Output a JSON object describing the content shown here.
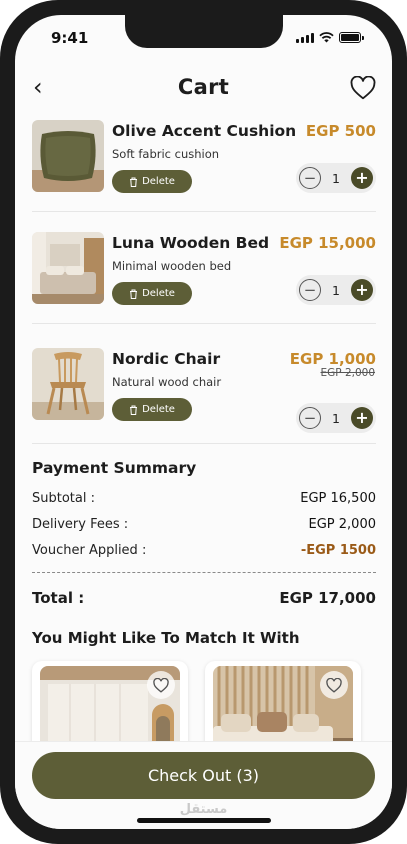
{
  "status_bar": {
    "time": "9:41"
  },
  "header": {
    "title": "Cart",
    "back_icon": "chevron-left-icon",
    "favorite_icon": "heart-icon"
  },
  "cart_items": [
    {
      "name": "Olive Accent Cushion",
      "description": "Soft fabric cushion",
      "price": "EGP 500",
      "old_price": "",
      "quantity": "1",
      "delete_label": "Delete",
      "image": "cushion-image"
    },
    {
      "name": "Luna Wooden Bed",
      "description": "Minimal wooden bed",
      "price": "EGP 15,000",
      "old_price": "",
      "quantity": "1",
      "delete_label": "Delete",
      "image": "bed-image"
    },
    {
      "name": "Nordic Chair",
      "description": "Natural wood chair",
      "price": "EGP 1,000",
      "old_price": "EGP 2,000",
      "quantity": "1",
      "delete_label": "Delete",
      "image": "chair-image"
    }
  ],
  "summary": {
    "title": "Payment Summary",
    "subtotal_label": "Subtotal :",
    "subtotal_value": "EGP 16,500",
    "delivery_label": "Delivery Fees :",
    "delivery_value": "EGP 2,000",
    "voucher_label": "Voucher Applied :",
    "voucher_value": "-EGP 1500",
    "total_label": "Total :",
    "total_value": "EGP 17,000"
  },
  "suggestions": {
    "title": "You Might Like To Match It With"
  },
  "checkout": {
    "label": "Check Out (3)"
  },
  "watermark": "مستقل",
  "colors": {
    "accent_olive": "#5d5e37",
    "price_orange": "#c78a2b",
    "discount_brown": "#9a5a17"
  }
}
